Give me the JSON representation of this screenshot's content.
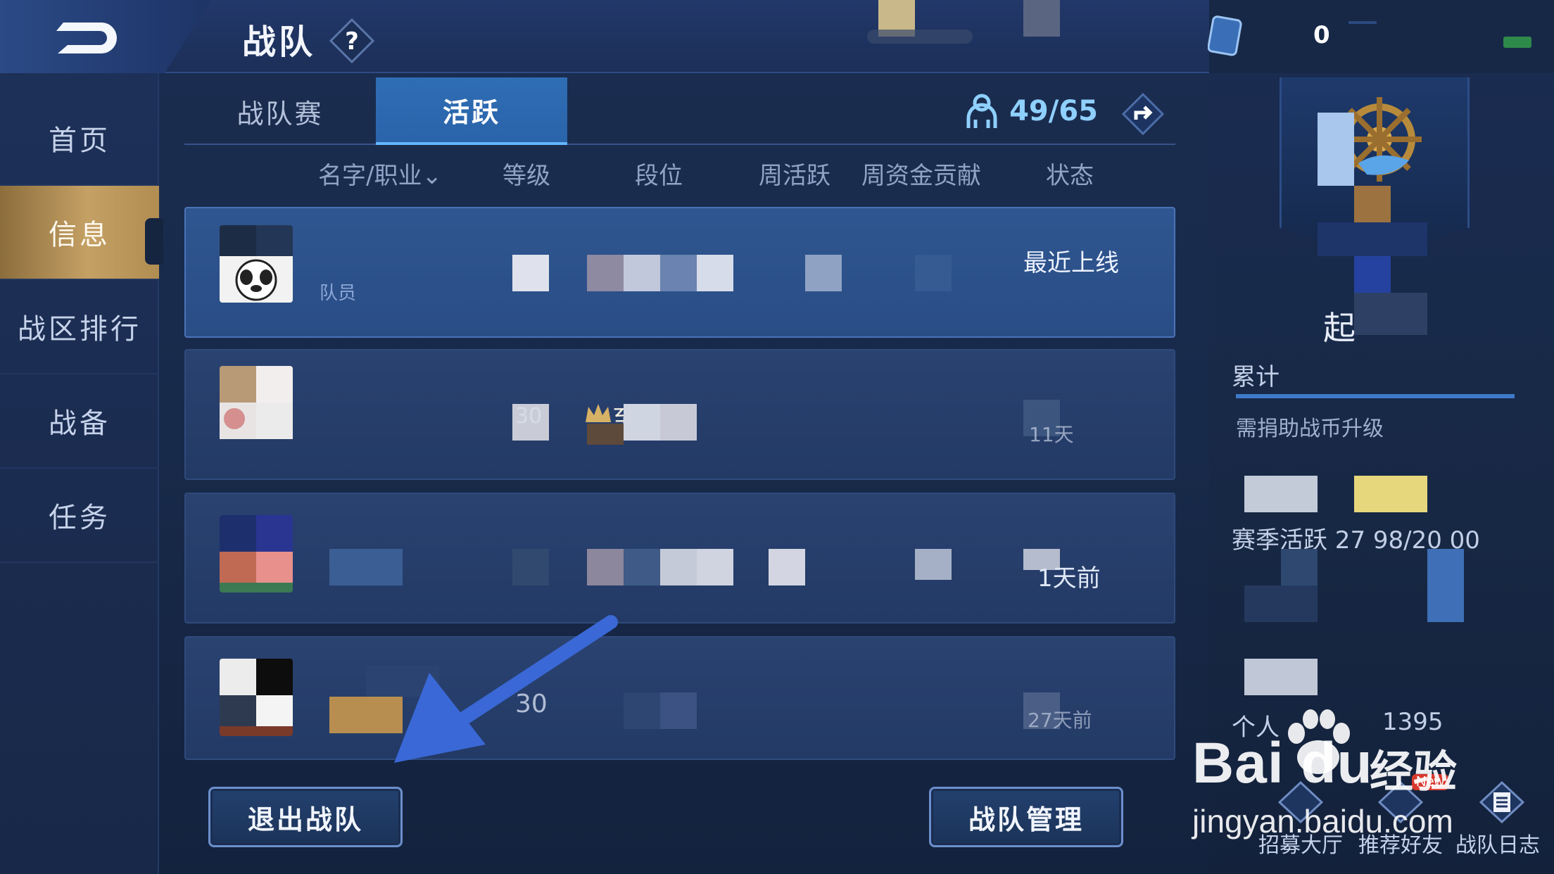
{
  "header": {
    "title": "战队",
    "help_icon": "question-diamond-icon",
    "back_icon": "back-arrow-icon"
  },
  "sidebar": {
    "items": [
      {
        "label": "首页",
        "active": false
      },
      {
        "label": "信息",
        "active": true
      },
      {
        "label": "战区排行",
        "active": false
      },
      {
        "label": "战备",
        "active": false
      },
      {
        "label": "任务",
        "active": false
      }
    ]
  },
  "tabs": [
    {
      "label": "战队赛",
      "active": false
    },
    {
      "label": "活跃",
      "active": true
    }
  ],
  "member_count": "49/65",
  "columns": [
    "名字/职业⌄",
    "等级",
    "段位",
    "周活跃",
    "周资金贡献",
    "状态"
  ],
  "members": [
    {
      "role": "队员",
      "status": "最近上线"
    },
    {
      "rank_prefix": "至",
      "level": "30",
      "status": "11天"
    },
    {
      "status": "1天前"
    },
    {
      "level": "30",
      "status": "27天前"
    }
  ],
  "buttons": {
    "quit": "退出战队",
    "manage": "战队管理"
  },
  "right_panel": {
    "card_count": "0",
    "team_name_fragment": "起",
    "cumulative_label": "累计",
    "upgrade_hint": "需捐助战币升级",
    "season_activity": "赛季活跃 27 98/20 00",
    "personal_label": "个人",
    "personal_value": "1395",
    "bottom_actions": [
      "招募大厅",
      "推荐好友",
      "战队日志"
    ],
    "new_badge": "New"
  },
  "watermark": {
    "logo": "Bai du",
    "suffix": "经验",
    "url": "jingyan.baidu.com"
  },
  "colors": {
    "accent_gold": "#c4a064",
    "active_tab": "#2f6db4",
    "arrow": "#3a68d6"
  }
}
